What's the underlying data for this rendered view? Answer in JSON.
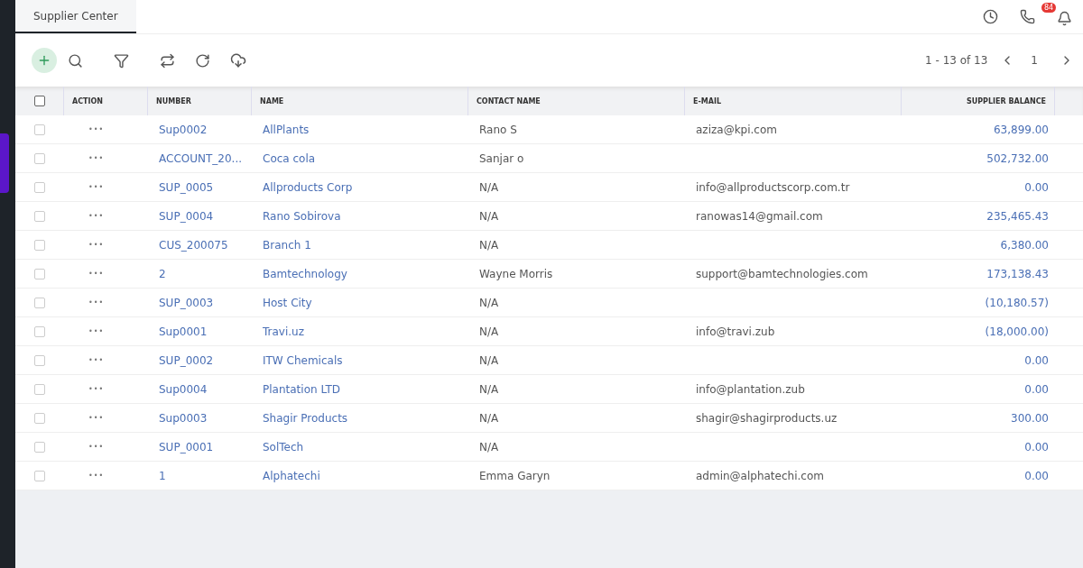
{
  "tabs": [
    {
      "label": "Supplier Center",
      "selected": true
    }
  ],
  "notifications": {
    "badge": "84"
  },
  "pagination": {
    "range": "1 - 13 of 13",
    "page": "1"
  },
  "table": {
    "select_all": false,
    "columns": [
      "ACTION",
      "NUMBER",
      "NAME",
      "CONTACT NAME",
      "E-MAIL",
      "SUPPLIER BALANCE"
    ],
    "rows": [
      {
        "checked": false,
        "action": "•••",
        "number": "Sup0002",
        "name": "AllPlants",
        "contact": "Rano S",
        "email": "aziza@kpi.com",
        "balance": "63,899.00"
      },
      {
        "checked": false,
        "action": "•••",
        "number": "ACCOUNT_20...",
        "name": "Coca cola",
        "contact": "Sanjar o",
        "email": "",
        "balance": "502,732.00"
      },
      {
        "checked": false,
        "action": "•••",
        "number": "SUP_0005",
        "name": "Allproducts Corp",
        "contact": "N/A",
        "email": "info@allproductscorp.com.tr",
        "balance": "0.00"
      },
      {
        "checked": false,
        "action": "•••",
        "number": "SUP_0004",
        "name": "Rano Sobirova",
        "contact": "N/A",
        "email": "ranowas14@gmail.com",
        "balance": "235,465.43"
      },
      {
        "checked": false,
        "action": "•••",
        "number": "CUS_200075",
        "name": "Branch 1",
        "contact": "N/A",
        "email": "",
        "balance": "6,380.00"
      },
      {
        "checked": false,
        "action": "•••",
        "number": "2",
        "name": "Bamtechnology",
        "contact": "Wayne Morris",
        "email": "support@bamtechnologies.com",
        "balance": "173,138.43"
      },
      {
        "checked": false,
        "action": "•••",
        "number": "SUP_0003",
        "name": "Host City",
        "contact": "N/A",
        "email": "",
        "balance": "(10,180.57)"
      },
      {
        "checked": false,
        "action": "•••",
        "number": "Sup0001",
        "name": "Travi.uz",
        "contact": "N/A",
        "email": "info@travi.zub",
        "balance": "(18,000.00)"
      },
      {
        "checked": false,
        "action": "•••",
        "number": "SUP_0002",
        "name": "ITW Chemicals",
        "contact": "N/A",
        "email": "",
        "balance": "0.00"
      },
      {
        "checked": false,
        "action": "•••",
        "number": "Sup0004",
        "name": "Plantation LTD",
        "contact": "N/A",
        "email": "info@plantation.zub",
        "balance": "0.00"
      },
      {
        "checked": false,
        "action": "•••",
        "number": "Sup0003",
        "name": "Shagir Products",
        "contact": "N/A",
        "email": "shagir@shagirproducts.uz",
        "balance": "300.00"
      },
      {
        "checked": false,
        "action": "•••",
        "number": "SUP_0001",
        "name": "SolTech",
        "contact": "N/A",
        "email": "",
        "balance": "0.00"
      },
      {
        "checked": false,
        "action": "•••",
        "number": "1",
        "name": "Alphatechi",
        "contact": "Emma Garyn",
        "email": "admin@alphatechi.com",
        "balance": "0.00"
      }
    ]
  }
}
